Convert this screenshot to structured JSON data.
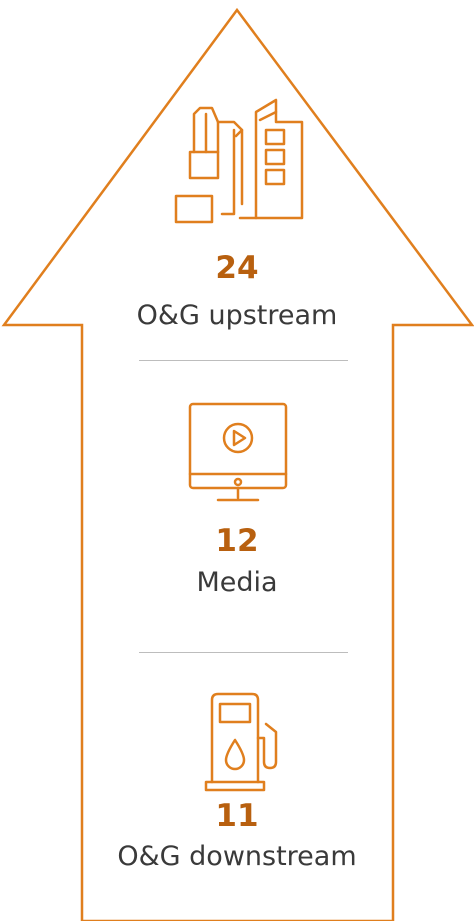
{
  "colors": {
    "accent": "#e07f1e",
    "value_text": "#b8600f",
    "label_text": "#3a3a3a",
    "divider": "#bdbdbd"
  },
  "items": [
    {
      "value": "24",
      "label": "O&G upstream",
      "icon": "oil-refinery-icon"
    },
    {
      "value": "12",
      "label": "Media",
      "icon": "media-monitor-play-icon"
    },
    {
      "value": "11",
      "label": "O&G downstream",
      "icon": "fuel-pump-icon"
    }
  ]
}
